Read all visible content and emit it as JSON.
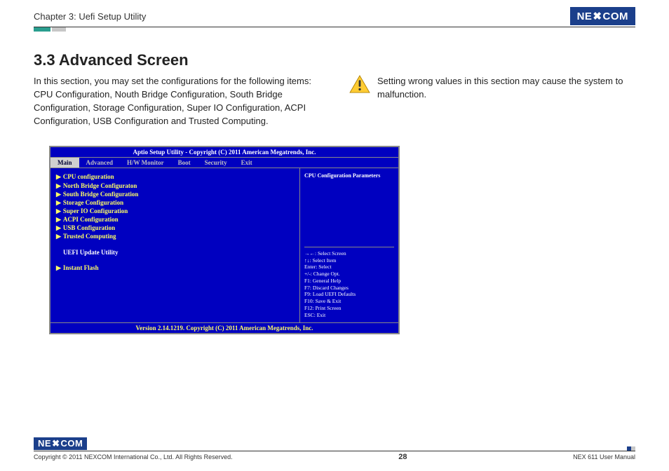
{
  "header": {
    "chapter": "Chapter 3: Uefi Setup Utility",
    "logo_text": "NE COM",
    "logo_x": "X"
  },
  "main": {
    "heading": "3.3 Advanced Screen",
    "intro": "In this section, you may set the configurations for the following items: CPU Configuration, Nouth Bridge Configuration, South Bridge Configuration, Storage Configuration, Super IO Configuration, ACPI Configuration, USB Configuration and Trusted Computing.",
    "warning": "Setting wrong values in this section may cause the system to malfunction."
  },
  "bios": {
    "title": "Aptio Setup Utility - Copyright (C) 2011 American Megatrends, Inc.",
    "tabs": [
      "Main",
      "Advanced",
      "H/W Monitor",
      "Boot",
      "Security",
      "Exit"
    ],
    "active_tab_index": 0,
    "items": [
      "CPU configuration",
      "North Bridge Configuraton",
      "South Bridge Configuration",
      "Storage Configuration",
      "Super IO Configuration",
      "ACPI Configuration",
      "USB Configuration",
      "Trusted Computing"
    ],
    "section_label": "UEFI Update Utility",
    "items2": [
      "Instant Flash"
    ],
    "help_title": "CPU Configuration Parameters",
    "keys": [
      "→←: Select Screen",
      "↑↓: Select Item",
      "Enter: Select",
      "+/-: Change Opt.",
      "F1: General Help",
      "F7: Discard Changes",
      "F9: Load UEFI Defaults",
      "F10: Save & Exit",
      "F12: Print Screen",
      "ESC: Exit"
    ],
    "footer": "Version 2.14.1219. Copyright (C) 2011 American Megatrends, Inc."
  },
  "footer": {
    "copyright": "Copyright © 2011 NEXCOM International Co., Ltd. All Rights Reserved.",
    "page": "28",
    "manual": "NEX 611 User Manual",
    "logo_text": "NE COM",
    "logo_x": "X"
  }
}
